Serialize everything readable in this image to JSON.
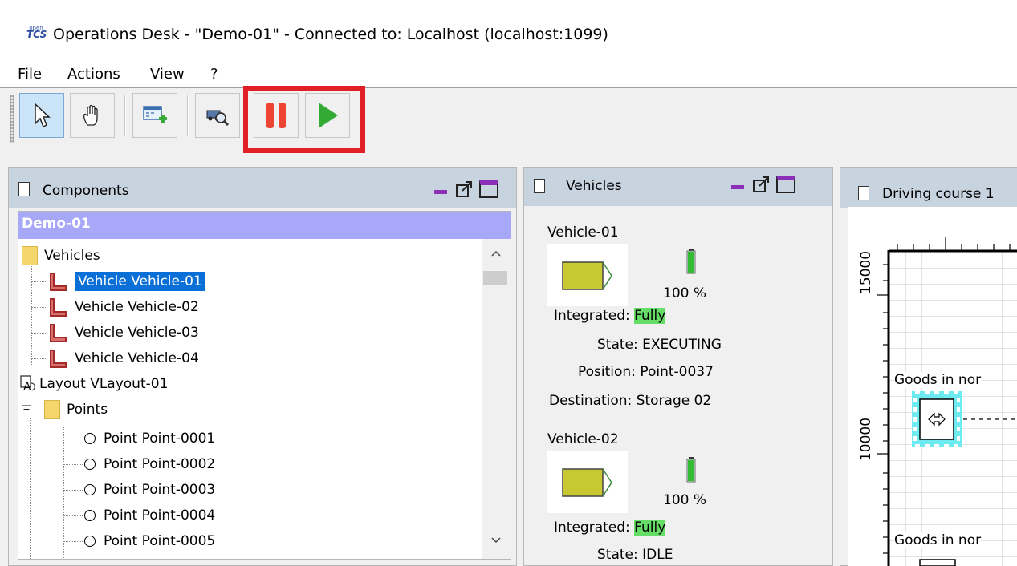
{
  "window": {
    "title": "Operations Desk - \"Demo-01\" - Connected to: Localhost (localhost:1099)",
    "logo_top": "open",
    "logo_main": "TCS"
  },
  "menu": [
    "File",
    "Actions",
    "View",
    "?"
  ],
  "toolbar": {
    "buttons": [
      "select-tool",
      "drag-tool",
      "create-transport-order",
      "find-vehicle",
      "pause-vehicles",
      "resume-vehicles"
    ]
  },
  "components_panel": {
    "title": "Components",
    "model_name": "Demo-01",
    "vehicles_folder": "Vehicles",
    "vehicles": [
      "Vehicle Vehicle-01",
      "Vehicle Vehicle-02",
      "Vehicle Vehicle-03",
      "Vehicle Vehicle-04"
    ],
    "layout": "Layout VLayout-01",
    "points_folder": "Points",
    "points": [
      "Point Point-0001",
      "Point Point-0002",
      "Point Point-0003",
      "Point Point-0004",
      "Point Point-0005"
    ]
  },
  "vehicles_panel": {
    "title": "Vehicles",
    "labels": {
      "integrated": "Integrated:",
      "state": "State:",
      "position": "Position:",
      "destination": "Destination:"
    },
    "cards": [
      {
        "name": "Vehicle-01",
        "energy": "100 %",
        "energy_level": 1.0,
        "integrated": "Fully",
        "state": "EXECUTING",
        "position": "Point-0037",
        "destination": "Storage 02"
      },
      {
        "name": "Vehicle-02",
        "energy": "100 %",
        "energy_level": 1.0,
        "integrated": "Fully",
        "state": "IDLE"
      }
    ],
    "vehicle_color": "#c8c832"
  },
  "course_panel": {
    "title": "Driving course 1",
    "ruler_labels": [
      "15000",
      "10000"
    ],
    "location_labels": [
      "Goods in nor",
      "Goods in nor"
    ]
  },
  "colors": {
    "panel_header": "#c8d3e0",
    "model_header": "#a8a8f8",
    "selection": "#0a6fd7",
    "highlight_box": "#e01f26",
    "fully_badge": "#66dd66",
    "vehicle_icon": "#a52a2a"
  }
}
